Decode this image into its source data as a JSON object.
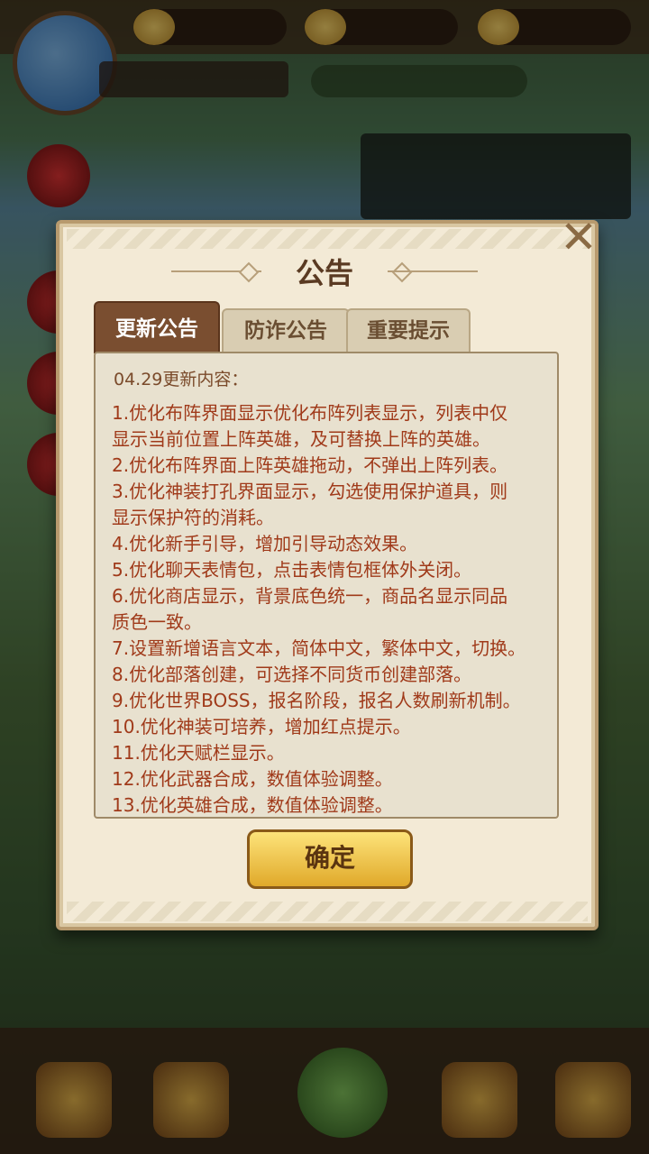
{
  "dialog": {
    "title": "公告",
    "close_icon": "close-icon",
    "tabs": [
      {
        "label": "更新公告",
        "active": true
      },
      {
        "label": "防诈公告",
        "active": false
      },
      {
        "label": "重要提示",
        "active": false
      }
    ],
    "content_heading": "04.29更新内容：",
    "items": [
      "1.优化布阵界面显示优化布阵列表显示，列表中仅",
      "显示当前位置上阵英雄，及可替换上阵的英雄。",
      "2.优化布阵界面上阵英雄拖动，不弹出上阵列表。",
      "3.优化神装打孔界面显示，勾选使用保护道具，则",
      "显示保护符的消耗。",
      "4.优化新手引导，增加引导动态效果。",
      "5.优化聊天表情包，点击表情包框体外关闭。",
      "6.优化商店显示，背景底色统一，商品名显示同品",
      "质色一致。",
      "7.设置新增语言文本，简体中文，繁体中文，切换。",
      "8.优化部落创建，可选择不同货币创建部落。",
      "9.优化世界BOSS，报名阶段，报名人数刷新机制。",
      "10.优化神装可培养，增加红点提示。",
      "11.优化天赋栏显示。",
      "12.优化武器合成，数值体验调整。",
      "13.优化英雄合成，数值体验调整。"
    ],
    "confirm_label": "确定"
  },
  "colors": {
    "panel": "#f3ead6",
    "tab_active": "#7a4e30",
    "item_text": "#a03a1a",
    "button": "#f2c94c"
  }
}
